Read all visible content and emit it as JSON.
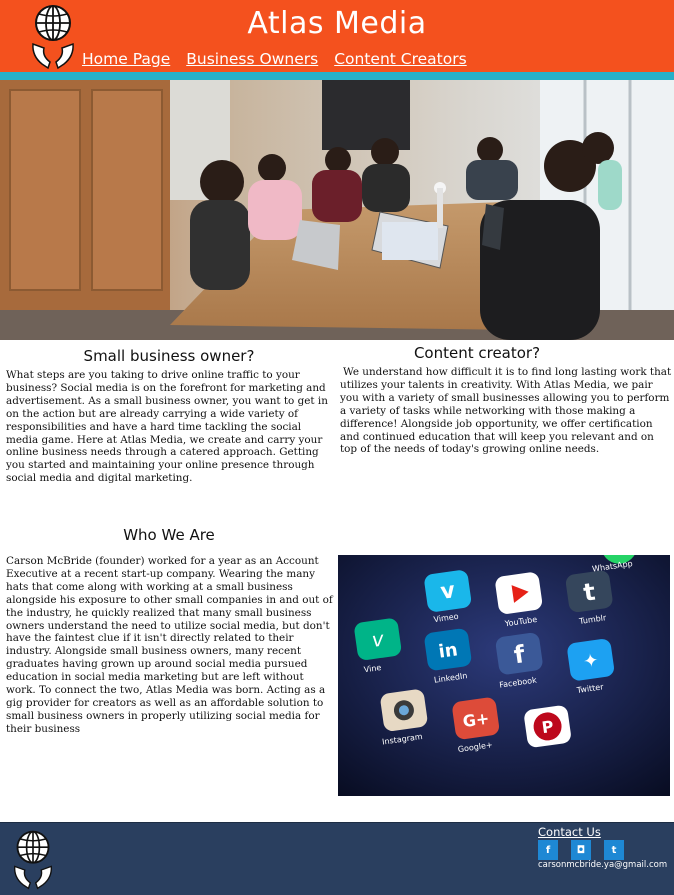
{
  "header": {
    "title": "Atlas Media",
    "nav": [
      "Home Page",
      "Business Owners",
      "Content Creators"
    ]
  },
  "icons": {
    "logo": "globe-in-hands-icon",
    "facebook": "facebook-icon",
    "instagram": "instagram-icon",
    "twitter": "twitter-icon"
  },
  "business": {
    "title": "Small business owner?",
    "body": "What steps are you taking to drive online traffic to your business? Social media is on the forefront for marketing and advertisement. As a small business owner, you want to get in on the action but are already carrying a wide variety of responsibilities and have a hard time tackling the social media game. Here at Atlas Media, we create and carry your online business needs through a catered approach. Getting you started and maintaining your online presence through social media and digital marketing."
  },
  "creator": {
    "title": "Content creator?",
    "body": "We understand how difficult it is to find long lasting work that utilizes your talents in creativity. With Atlas Media, we pair you with a variety of small businesses allowing you to perform a variety of tasks while networking with those making a difference! Alongside job opportunity, we offer certification and continued education that will keep you relevant and on top of the needs of today's growing online needs."
  },
  "about": {
    "title": "Who We Are",
    "body": "Carson McBride (founder) worked for a year as an Account Executive at a recent start-up company. Wearing the many hats that come along with working at a small business alongside his exposure to other small companies in and out of the industry, he quickly realized that many small business owners understand the need to utilize social media, but don't have the faintest clue if it isn't directly related to their industry. Alongside small business owners, many recent graduates having grown up around social media pursued education in social media marketing but are left without work. To connect the two, Atlas Media was born. Acting as a gig provider for creators as well as an affordable solution to small business owners in properly utilizing social media for their business",
    "apps": [
      "WhatsApp",
      "Vimeo",
      "YouTube",
      "Tumblr",
      "Vine",
      "LinkedIn",
      "Facebook",
      "Twitter",
      "Instagram",
      "Google+"
    ]
  },
  "footer": {
    "contact": "Contact Us",
    "email": "carsonmcbride.ya@gmail.com",
    "social": [
      "f",
      "◘",
      "t"
    ]
  },
  "colors": {
    "header": "#f4511e",
    "strip": "#26b0c9",
    "footer": "#2a3f5f",
    "social": "#1e88d4"
  }
}
